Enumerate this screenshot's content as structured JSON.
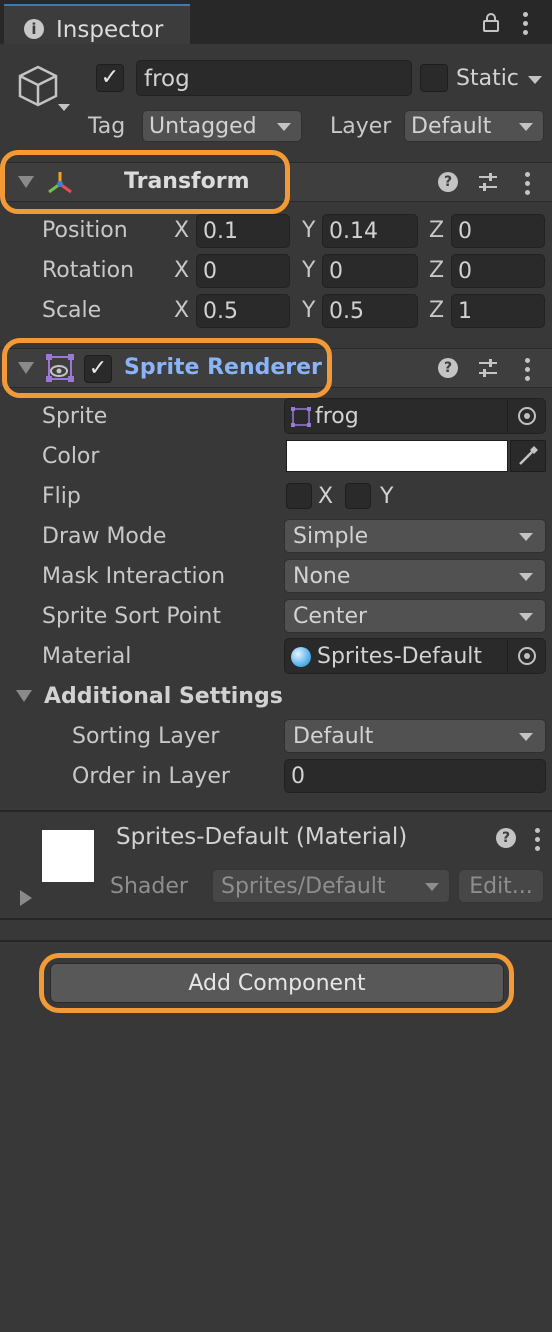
{
  "tab": {
    "title": "Inspector"
  },
  "object": {
    "name": "frog",
    "active": true,
    "static_label": "Static",
    "static_checked": false
  },
  "tag": {
    "label": "Tag",
    "value": "Untagged"
  },
  "layer": {
    "label": "Layer",
    "value": "Default"
  },
  "transform": {
    "title": "Transform",
    "rows": [
      {
        "label": "Position",
        "x": "0.1",
        "y": "0.14",
        "z": "0"
      },
      {
        "label": "Rotation",
        "x": "0",
        "y": "0",
        "z": "0"
      },
      {
        "label": "Scale",
        "x": "0.5",
        "y": "0.5",
        "z": "1"
      }
    ],
    "axes": {
      "x": "X",
      "y": "Y",
      "z": "Z"
    }
  },
  "sprite_renderer": {
    "title": "Sprite Renderer",
    "enabled": true,
    "sprite": {
      "label": "Sprite",
      "value": "frog"
    },
    "color": {
      "label": "Color",
      "value": "#ffffff"
    },
    "flip": {
      "label": "Flip",
      "x_label": "X",
      "y_label": "Y",
      "x_checked": false,
      "y_checked": false
    },
    "draw_mode": {
      "label": "Draw Mode",
      "value": "Simple"
    },
    "mask_interaction": {
      "label": "Mask Interaction",
      "value": "None"
    },
    "sort_point": {
      "label": "Sprite Sort Point",
      "value": "Center"
    },
    "material": {
      "label": "Material",
      "value": "Sprites-Default"
    },
    "additional": {
      "title": "Additional Settings",
      "sorting_layer": {
        "label": "Sorting Layer",
        "value": "Default"
      },
      "order_in_layer": {
        "label": "Order in Layer",
        "value": "0"
      }
    }
  },
  "material_panel": {
    "title": "Sprites-Default (Material)",
    "shader_label": "Shader",
    "shader_value": "Sprites/Default",
    "edit_label": "Edit..."
  },
  "add_component": {
    "label": "Add Component"
  },
  "colors": {
    "background": "#383838",
    "highlight": "#f19a36",
    "selected_text": "#8ab4f8",
    "tab_accent": "#3a79bb"
  }
}
